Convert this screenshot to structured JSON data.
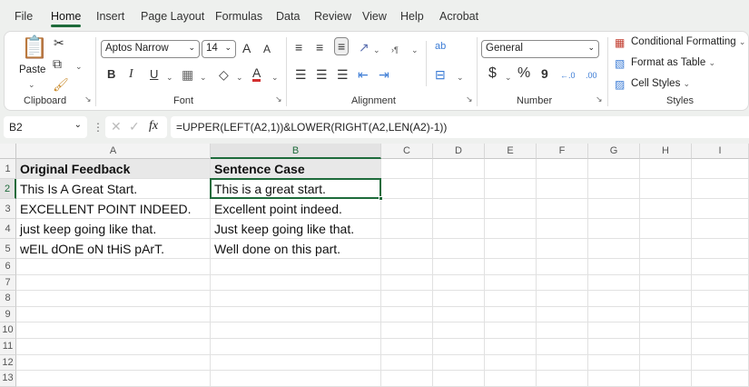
{
  "menu": [
    "File",
    "Home",
    "Insert",
    "Page Layout",
    "Formulas",
    "Data",
    "Review",
    "View",
    "Help",
    "Acrobat"
  ],
  "ribbon": {
    "clipboard": {
      "paste": "Paste",
      "group": "Clipboard"
    },
    "font": {
      "name": "Aptos Narrow",
      "size": "14",
      "bold": "B",
      "italic": "I",
      "underline": "U",
      "grow": "A",
      "shrink": "A",
      "color": "A",
      "group": "Font",
      "font_color": "#d32f2f"
    },
    "alignment": {
      "group": "Alignment",
      "wrap": "ab"
    },
    "number": {
      "format": "General",
      "currency": "$",
      "percent": "%",
      "comma": "9",
      "inc": "←.0",
      "dec": ".00",
      "group": "Number"
    },
    "styles": {
      "conditional": "Conditional Formatting",
      "table": "Format as Table",
      "cell": "Cell Styles",
      "group": "Styles"
    }
  },
  "formula_bar": {
    "name_box": "B2",
    "fx": "fx",
    "formula": "=UPPER(LEFT(A2,1))&LOWER(RIGHT(A2,LEN(A2)-1))"
  },
  "columns": [
    "A",
    "B",
    "C",
    "D",
    "E",
    "F",
    "G",
    "H",
    "I"
  ],
  "rows": [
    "1",
    "2",
    "3",
    "4",
    "5",
    "6",
    "7",
    "8",
    "9",
    "10",
    "11",
    "12",
    "13"
  ],
  "cells": {
    "A": [
      "Original Feedback",
      "This Is A Great Start.",
      "EXCELLENT POINT INDEED.",
      "just keep going like that.",
      "wEIL dOnE oN tHiS pArT."
    ],
    "B": [
      "Sentence Case",
      "This is a great start.",
      "Excellent point indeed.",
      "Just keep going like that.",
      "Well done on this part."
    ]
  },
  "accent": "#1e6b3b"
}
